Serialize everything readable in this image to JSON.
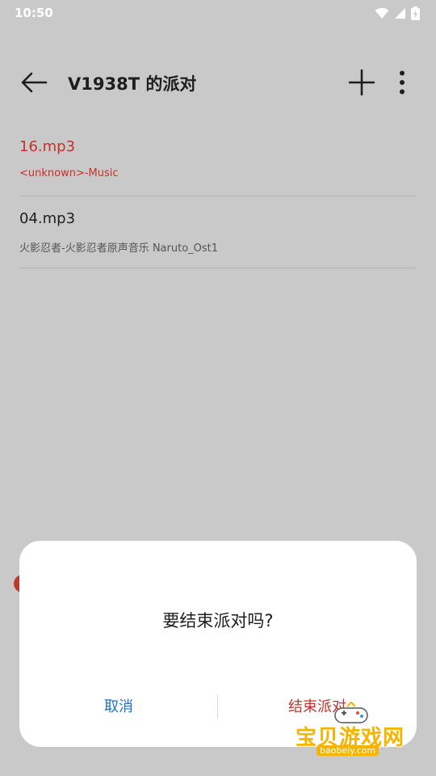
{
  "status_bar": {
    "time": "10:50"
  },
  "toolbar": {
    "title": "V1938T 的派对"
  },
  "songs": [
    {
      "title": "16.mp3",
      "subtitle": "<unknown>-Music",
      "playing": true
    },
    {
      "title": "04.mp3",
      "subtitle": "火影忍者-火影忍者原声音乐 Naruto_Ost1",
      "playing": false
    }
  ],
  "dialog": {
    "message": "要结束派对吗?",
    "cancel_label": "取消",
    "confirm_label": "结束派对"
  },
  "watermark": {
    "text": "宝贝游戏网",
    "url": "baobeiy.com"
  },
  "colors": {
    "accent_red": "#c8302b",
    "accent_blue": "#1f6fd1",
    "watermark_yellow": "#f5b400"
  }
}
